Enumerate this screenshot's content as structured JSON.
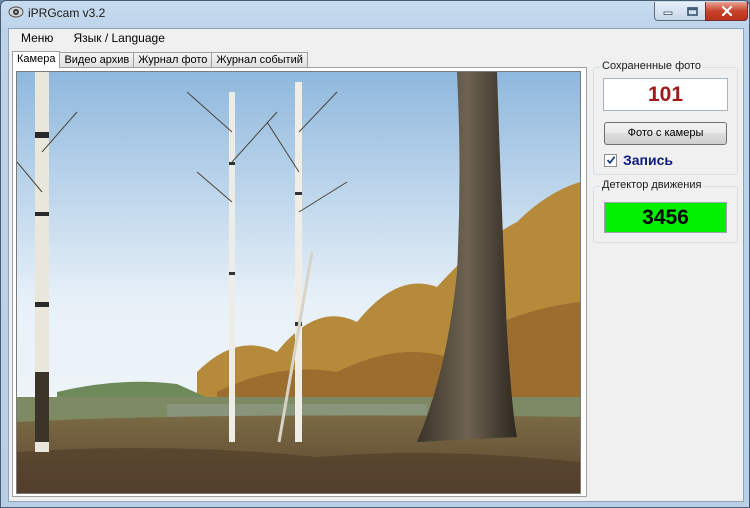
{
  "window": {
    "title": "iPRGcam v3.2"
  },
  "menu": {
    "items": [
      "Меню",
      "Язык / Language"
    ]
  },
  "tabs": [
    "Камера",
    "Видео архив",
    "Журнал фото",
    "Журнал событий"
  ],
  "saved_photos": {
    "group_label": "Сохраненные фото",
    "count": "101",
    "camera_button_label": "Фото с камеры",
    "record_label": "Запись",
    "record_checked": true
  },
  "motion_detector": {
    "group_label": "Детектор движения",
    "value": "3456",
    "indicator_color": "#00f000"
  },
  "icons": {
    "app": "webcam-icon",
    "minimize": "minimize-icon",
    "maximize": "maximize-icon",
    "close": "close-icon",
    "check": "check-icon"
  }
}
